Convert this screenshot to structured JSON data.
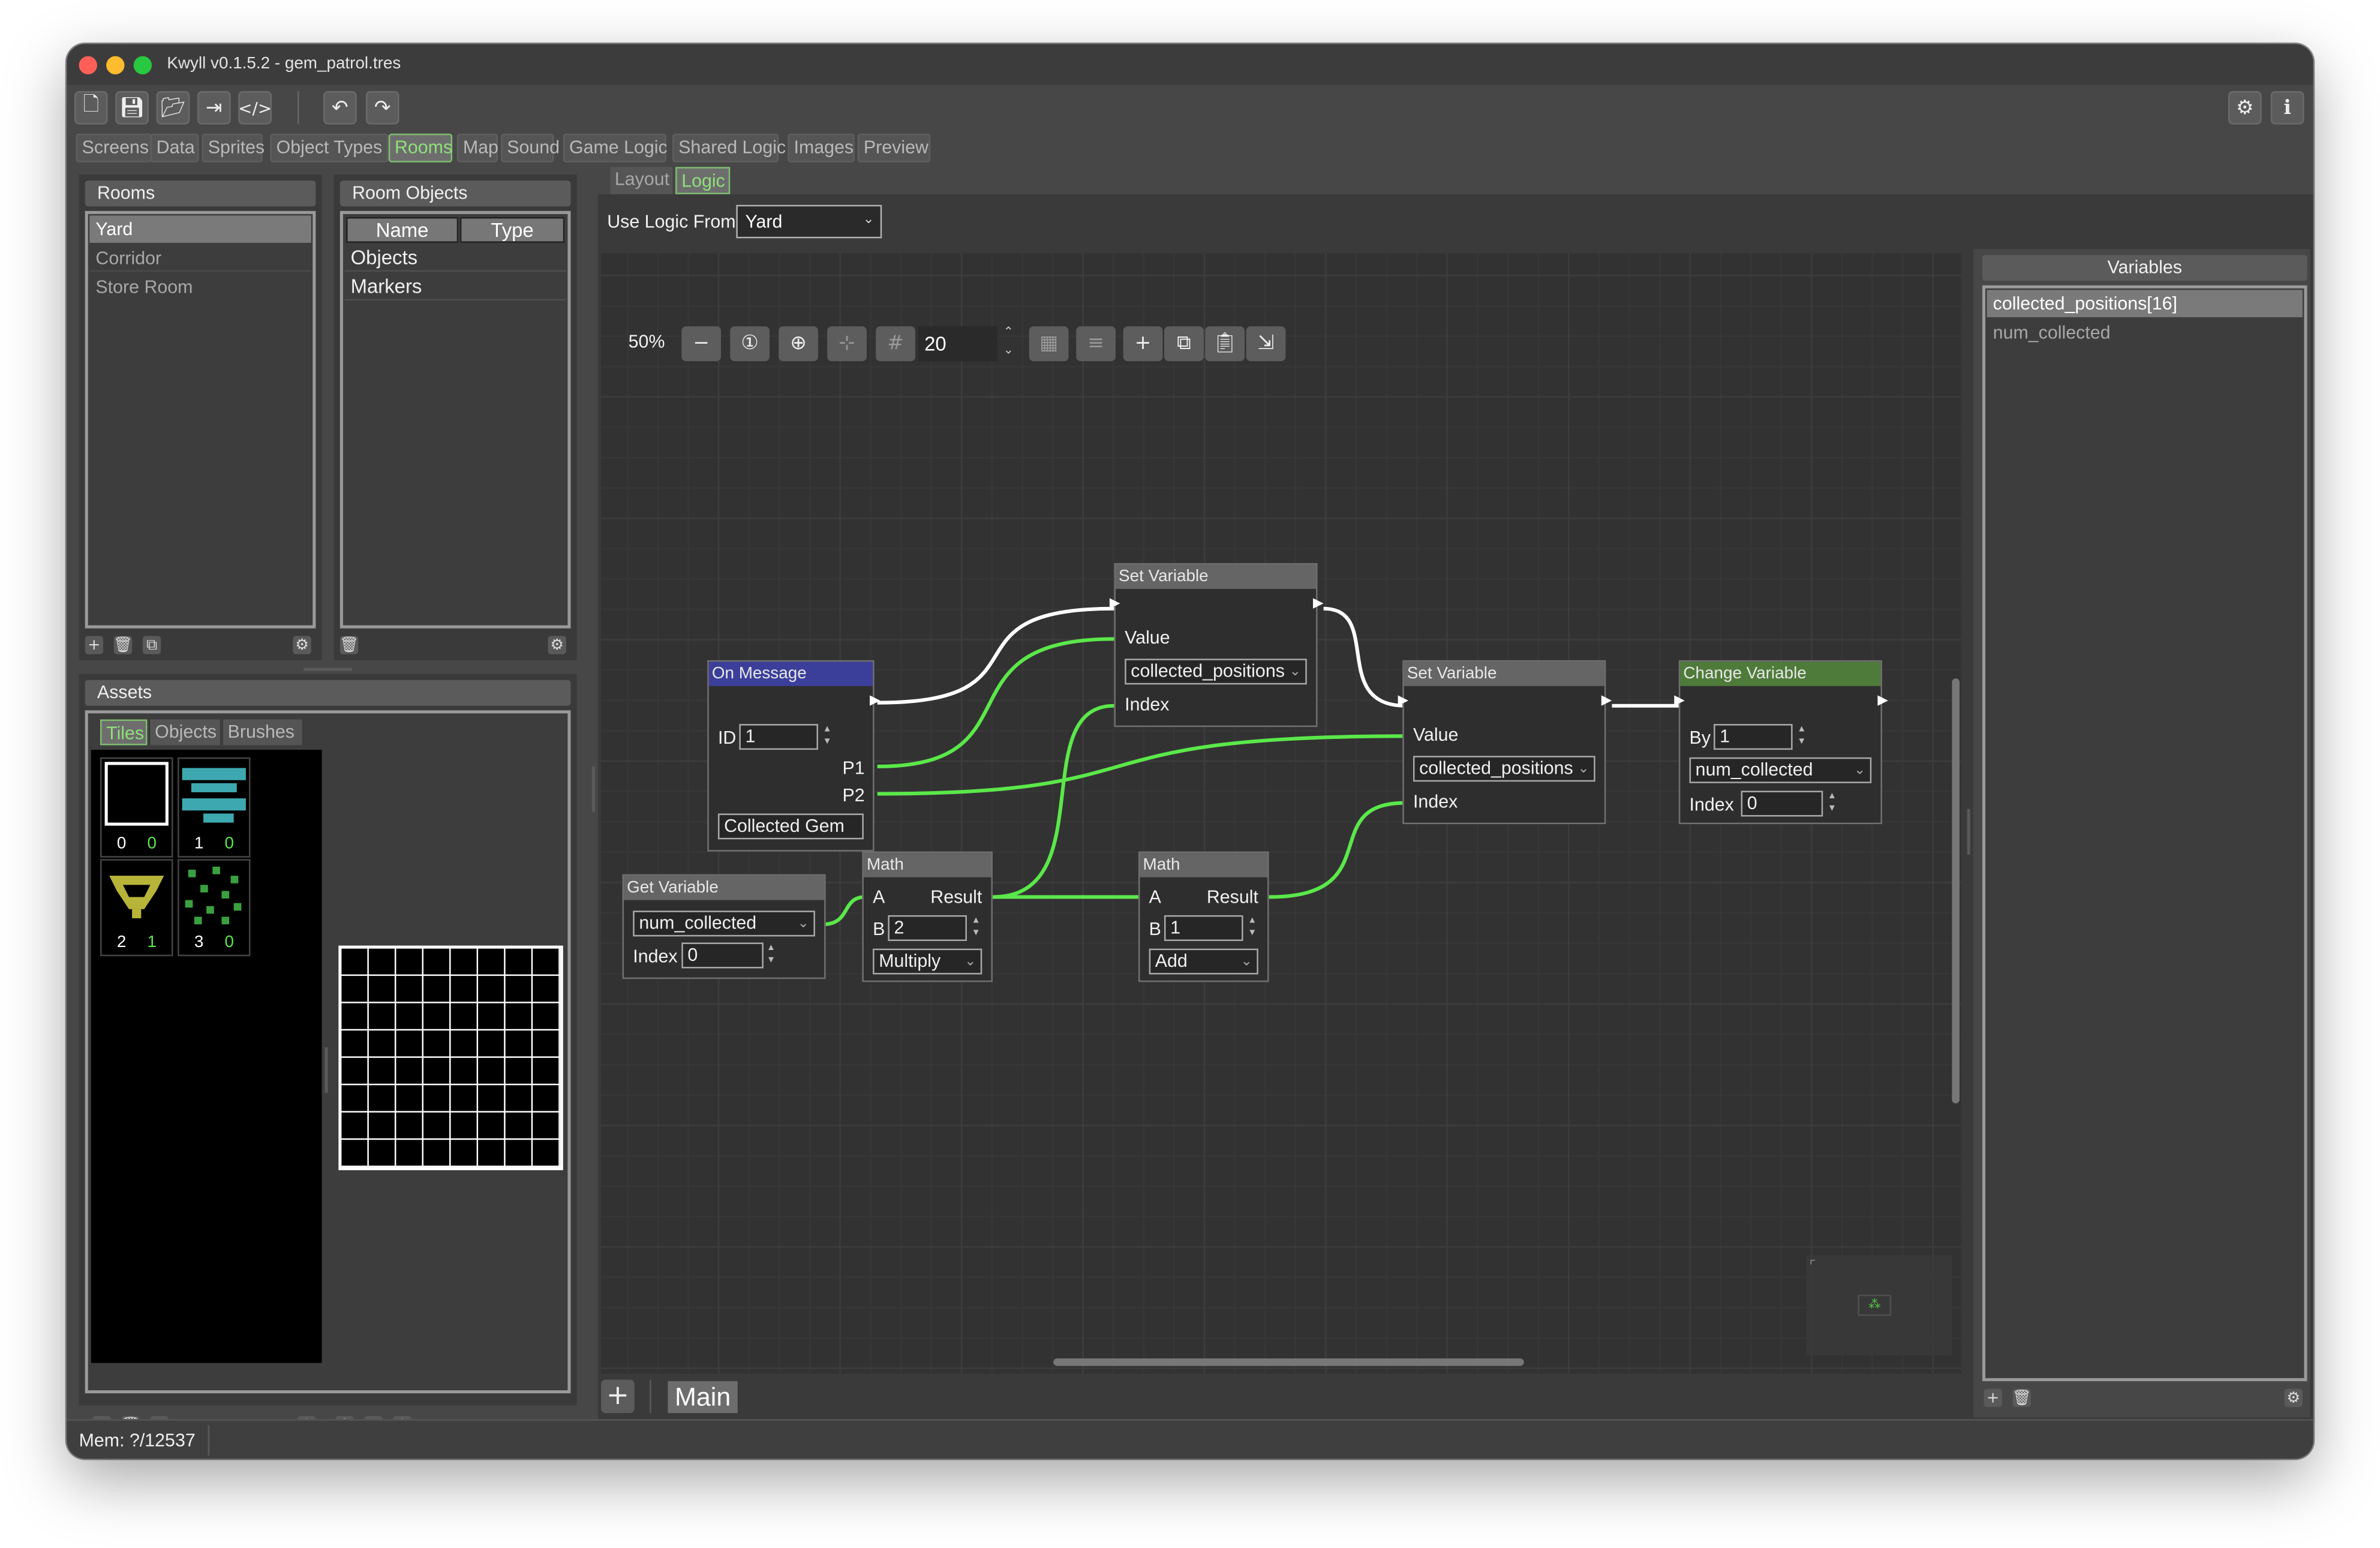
{
  "window": {
    "title": "Kwyll v0.1.5.2 - gem_patrol.tres"
  },
  "toolbar": {
    "icons": [
      "new-file-icon",
      "save-icon",
      "open-folder-icon",
      "export-icon",
      "code-icon",
      "undo-icon",
      "redo-icon",
      "settings-icon",
      "info-icon"
    ]
  },
  "main_tabs": [
    "Screens",
    "Data",
    "Sprites",
    "Object Types",
    "Rooms",
    "Map",
    "Sound",
    "Game Logic",
    "Shared Logic",
    "Images",
    "Preview"
  ],
  "main_tabs_active": "Rooms",
  "rooms_panel": {
    "title": "Rooms",
    "items": [
      "Yard",
      "Corridor",
      "Store Room"
    ],
    "selected": "Yard"
  },
  "room_objects_panel": {
    "title": "Room Objects",
    "columns": [
      "Name",
      "Type"
    ],
    "rows": [
      "Objects",
      "Markers"
    ]
  },
  "assets_panel": {
    "title": "Assets",
    "tabs": [
      "Tiles",
      "Objects",
      "Brushes"
    ],
    "active_tab": "Tiles",
    "tiles": [
      {
        "a": "0",
        "b": "0"
      },
      {
        "a": "1",
        "b": "0"
      },
      {
        "a": "2",
        "b": "1"
      },
      {
        "a": "3",
        "b": "0"
      }
    ]
  },
  "logic_view": {
    "sub_tabs": [
      "Layout",
      "Logic"
    ],
    "active_sub_tab": "Logic",
    "use_logic_from_label": "Use Logic From",
    "use_logic_from_value": "Yard",
    "zoom": "50%",
    "grid_size": "20",
    "graph_tab": "Main",
    "add_graph_label": "+"
  },
  "nodes": {
    "on_message": {
      "title": "On Message",
      "id_label": "ID",
      "id_value": "1",
      "p1": "P1",
      "p2": "P2",
      "message": "Collected Gem"
    },
    "get_variable": {
      "title": "Get Variable",
      "variable": "num_collected",
      "index_label": "Index",
      "index_value": "0"
    },
    "math1": {
      "title": "Math",
      "a": "A",
      "result": "Result",
      "b": "B",
      "b_value": "2",
      "op": "Multiply"
    },
    "math2": {
      "title": "Math",
      "a": "A",
      "result": "Result",
      "b": "B",
      "b_value": "1",
      "op": "Add"
    },
    "set_variable1": {
      "title": "Set Variable",
      "value_label": "Value",
      "variable": "collected_positions",
      "index_label": "Index"
    },
    "set_variable2": {
      "title": "Set Variable",
      "value_label": "Value",
      "variable": "collected_positions",
      "index_label": "Index"
    },
    "change_variable": {
      "title": "Change Variable",
      "by_label": "By",
      "by_value": "1",
      "variable": "num_collected",
      "index_label": "Index",
      "index_value": "0"
    }
  },
  "variables_panel": {
    "title": "Variables",
    "items": [
      "collected_positions[16]",
      "num_collected"
    ],
    "selected": "collected_positions[16]"
  },
  "status_bar": {
    "mem": "Mem: ?/12537"
  },
  "colors": {
    "wire_green": "#5be84a",
    "wire_white": "#ffffff",
    "on_message_header": "#3b3f9a",
    "change_variable_header": "#4f7b3a",
    "active_tab": "#8fe07a"
  }
}
